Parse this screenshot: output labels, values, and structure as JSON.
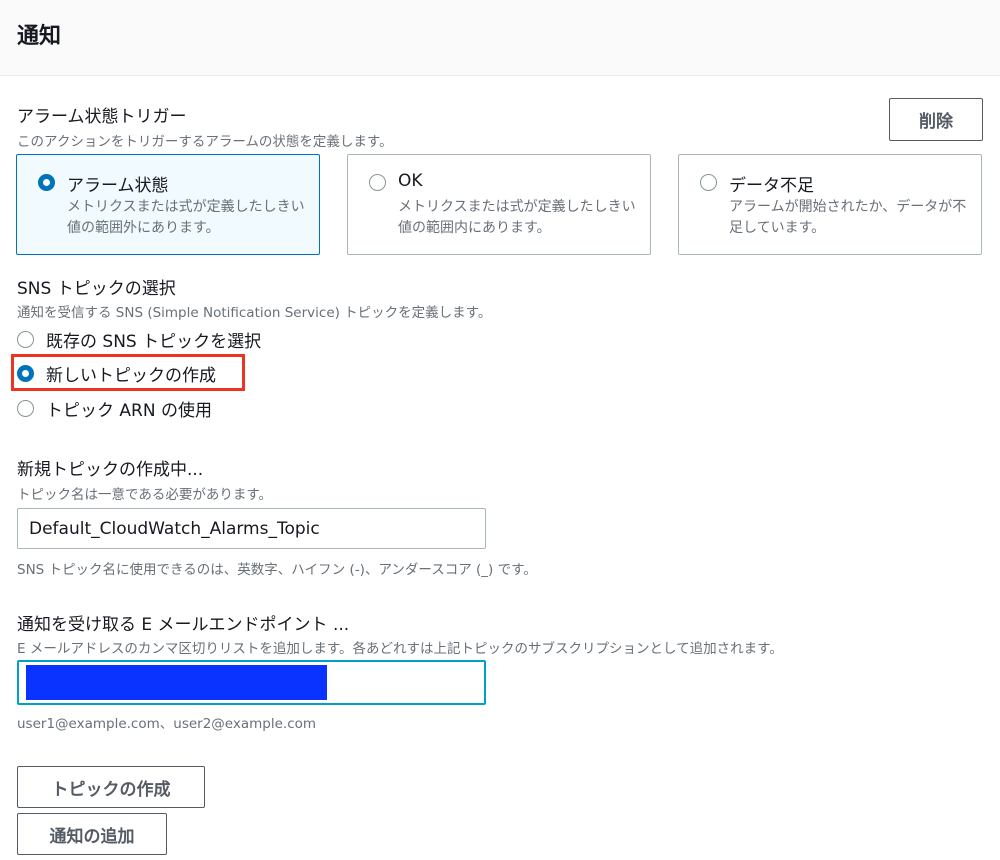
{
  "header": {
    "title": "通知"
  },
  "alarm_trigger": {
    "label": "アラーム状態トリガー",
    "description": "このアクションをトリガーするアラームの状態を定義します。",
    "remove_button": "削除",
    "options": [
      {
        "title": "アラーム状態",
        "description": "メトリクスまたは式が定義したしきい値の範囲外にあります。",
        "selected": true
      },
      {
        "title": "OK",
        "description": "メトリクスまたは式が定義したしきい値の範囲内にあります。",
        "selected": false
      },
      {
        "title": "データ不足",
        "description": "アラームが開始されたか、データが不足しています。",
        "selected": false
      }
    ]
  },
  "sns_topic": {
    "label": "SNS トピックの選択",
    "description": "通知を受信する SNS (Simple Notification Service) トピックを定義します。",
    "options": [
      {
        "label": "既存の SNS トピックを選択",
        "selected": false
      },
      {
        "label": "新しいトピックの作成",
        "selected": true
      },
      {
        "label": "トピック ARN の使用",
        "selected": false
      }
    ]
  },
  "new_topic": {
    "label": "新規トピックの作成中...",
    "description": "トピック名は一意である必要があります。",
    "value": "Default_CloudWatch_Alarms_Topic",
    "hint": "SNS トピック名に使用できるのは、英数字、ハイフン (-)、アンダースコア (_) です。"
  },
  "email_endpoints": {
    "label": "通知を受け取る E メールエンドポイント ...",
    "description": "E メールアドレスのカンマ区切りリストを追加します。各あどれすは上記トピックのサブスクリプションとして追加されます。",
    "value": "",
    "hint": "user1@example.com、user2@example.com"
  },
  "buttons": {
    "create_topic": "トピックの作成",
    "add_notification": "通知の追加"
  },
  "colors": {
    "accent": "#0073bb",
    "highlight_box": "#ee3322",
    "redaction": "#0a33ff",
    "focus_border": "#00a1c9"
  }
}
